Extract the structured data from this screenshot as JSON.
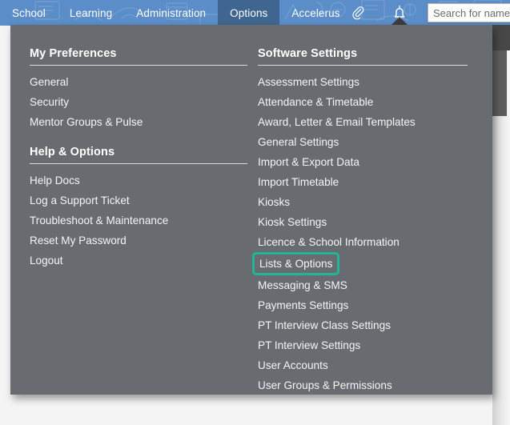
{
  "topbar": {
    "nav_items": [
      {
        "label": "School",
        "active": false
      },
      {
        "label": "Learning",
        "active": false
      },
      {
        "label": "Administration",
        "active": false
      },
      {
        "label": "Options",
        "active": true
      },
      {
        "label": "Accelerus",
        "active": false
      }
    ],
    "attach_icon": "paperclip-icon",
    "bell_icon": "bell-icon",
    "search": {
      "placeholder": "Search for name...",
      "value": ""
    },
    "accent_blue": "#5b8dc8",
    "active_tab_blue": "#3f6690"
  },
  "dropdown": {
    "panel_bg": "#686c70",
    "highlight_color": "#1fb897",
    "left_column": {
      "sections": [
        {
          "title": "My Preferences",
          "items": [
            {
              "label": "General",
              "highlighted": false
            },
            {
              "label": "Security",
              "highlighted": false
            },
            {
              "label": "Mentor Groups & Pulse",
              "highlighted": false
            }
          ]
        },
        {
          "title": "Help & Options",
          "items": [
            {
              "label": "Help Docs",
              "highlighted": false
            },
            {
              "label": "Log a Support Ticket",
              "highlighted": false
            },
            {
              "label": "Troubleshoot & Maintenance",
              "highlighted": false
            },
            {
              "label": "Reset My Password",
              "highlighted": false
            },
            {
              "label": "Logout",
              "highlighted": false
            }
          ]
        }
      ]
    },
    "right_column": {
      "sections": [
        {
          "title": "Software Settings",
          "items": [
            {
              "label": "Assessment Settings",
              "highlighted": false
            },
            {
              "label": "Attendance & Timetable",
              "highlighted": false
            },
            {
              "label": "Award, Letter & Email Templates",
              "highlighted": false
            },
            {
              "label": "General Settings",
              "highlighted": false
            },
            {
              "label": "Import & Export Data",
              "highlighted": false
            },
            {
              "label": "Import Timetable",
              "highlighted": false
            },
            {
              "label": "Kiosks",
              "highlighted": false
            },
            {
              "label": "Kiosk Settings",
              "highlighted": false
            },
            {
              "label": "Licence & School Information",
              "highlighted": false
            },
            {
              "label": "Lists & Options",
              "highlighted": true
            },
            {
              "label": "Messaging & SMS",
              "highlighted": false
            },
            {
              "label": "Payments Settings",
              "highlighted": false
            },
            {
              "label": "PT Interview Class Settings",
              "highlighted": false
            },
            {
              "label": "PT Interview Settings",
              "highlighted": false
            },
            {
              "label": "User Accounts",
              "highlighted": false
            },
            {
              "label": "User Groups & Permissions",
              "highlighted": false
            }
          ]
        }
      ]
    }
  }
}
